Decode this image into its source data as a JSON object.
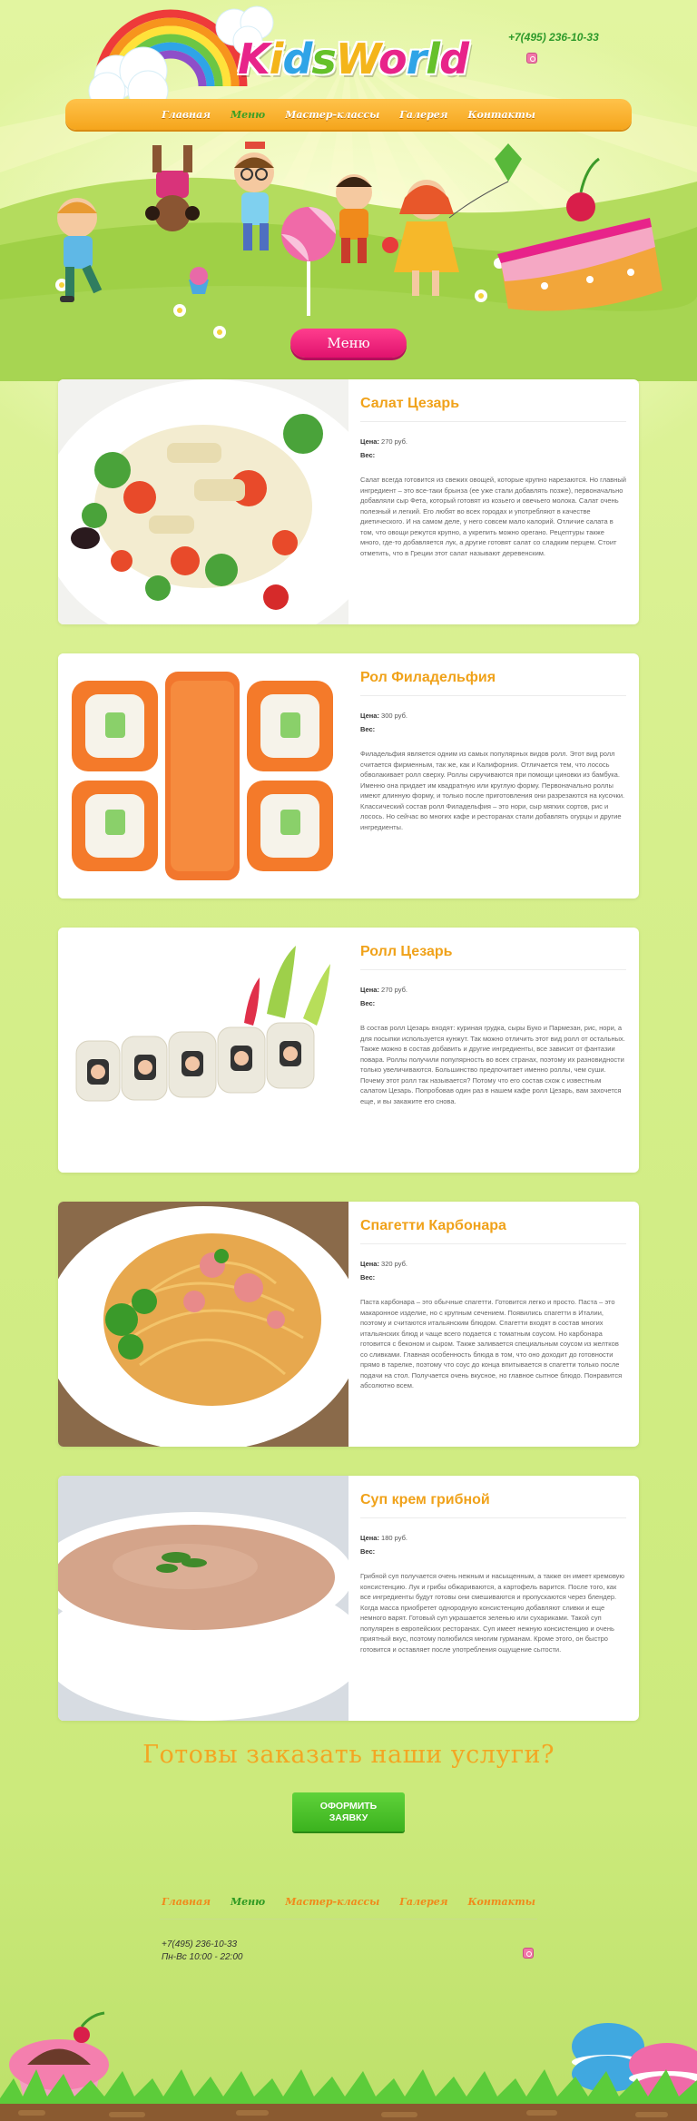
{
  "header": {
    "logo_text": "KidsWorld",
    "logo_letters": [
      {
        "ch": "K",
        "color": "#e8238a"
      },
      {
        "ch": "i",
        "color": "#f4b51a"
      },
      {
        "ch": "d",
        "color": "#2fa4e7"
      },
      {
        "ch": "s",
        "color": "#66c12a"
      },
      {
        "ch": "W",
        "color": "#f4b51a"
      },
      {
        "ch": "o",
        "color": "#e8238a"
      },
      {
        "ch": "r",
        "color": "#2fa4e7"
      },
      {
        "ch": "l",
        "color": "#66c12a"
      },
      {
        "ch": "d",
        "color": "#e8238a"
      }
    ],
    "phone": "+7(495) 236-10-33",
    "instagram_icon": "instagram-icon"
  },
  "nav": {
    "items": [
      {
        "label": "Главная",
        "active": false
      },
      {
        "label": "Меню",
        "active": true
      },
      {
        "label": "Мастер-классы",
        "active": false
      },
      {
        "label": "Галерея",
        "active": false
      },
      {
        "label": "Контакты",
        "active": false
      }
    ]
  },
  "menu_title": "Меню",
  "dishes": [
    {
      "title": "Салат Цезарь",
      "price_label": "Цена:",
      "price": "270 руб.",
      "weight_label": "Вес:",
      "description": "Салат всегда готовится из свежих овощей, которые крупно нарезаются. Но главный ингредиент – это все-таки брынза (ее уже стали добавлять позже), первоначально добавляли сыр Фета, который готовят из козьего и овечьего молока. Салат очень полезный и легкий. Его любят во всех городах и употребляют в качестве диетического. И на самом деле, у него совсем мало калорий. Отличие салата в том, что овощи режутся крупно, а укрепить можно орегано. Рецептуры также много, где-то добавляется лук, а другие готовят салат со сладким перцем. Стоит отметить, что в Греции этот салат называют деревенским.",
      "image": "caesar-salad"
    },
    {
      "title": "Рол Филадельфия",
      "price_label": "Цена:",
      "price": "300 руб.",
      "weight_label": "Вес:",
      "description": "Филадельфия является одним из самых популярных видов ролл. Этот вид ролл считается фирменным, так же, как и Калифорния. Отличается тем, что лосось обволакивает ролл сверху. Роллы скручиваются при помощи циновки из бамбука. Именно она придает им квадратную или круглую форму. Первоначально роллы имеют длинную форму, и только после приготовления они разрезаются на кусочки. Классический состав ролл Филадельфия – это нори, сыр мягких сортов, рис и лосось. Но сейчас во многих кафе и ресторанах стали добавлять огурцы и другие ингредиенты.",
      "image": "philadelphia-roll"
    },
    {
      "title": "Ролл Цезарь",
      "price_label": "Цена:",
      "price": "270 руб.",
      "weight_label": "Вес:",
      "description": "В состав ролл Цезарь входят: куриная грудка, сыры Буко и Пармезан, рис, нори, а для посыпки используется кунжут. Так можно отличить этот вид ролл от остальных. Также можно в состав добавить и другие ингредиенты, все зависит от фантазии повара. Роллы получили популярность во всех странах, поэтому их разновидности только увеличиваются. Большинство предпочитает именно роллы, чем суши. Почему этот ролл так называется? Потому что его состав схож с известным салатом Цезарь. Попробовав один раз в нашем кафе ролл Цезарь, вам захочется еще, и вы закажите его снова.",
      "image": "caesar-roll"
    },
    {
      "title": "Спагетти Карбонара",
      "price_label": "Цена:",
      "price": "320 руб.",
      "weight_label": "Вес:",
      "description": "Паста карбонара – это обычные спагетти. Готовится легко и просто. Паста – это макаронное изделие, но с крупным сечением. Появились спагетти в Италии, поэтому и считаются итальянским блюдом. Спагетти входят в состав многих итальянских блюд и чаще всего подается с томатным соусом. Но карбонара готовится с беконом и сыром. Также заливается специальным соусом из желтков со сливками. Главная особенность блюда в том, что оно доходит до готовности прямо в тарелке, поэтому что соус до конца впитывается в спагетти только после подачи на стол. Получается очень вкусное, но главное сытное блюдо. Понравится абсолютно всем.",
      "image": "spaghetti-carbonara"
    },
    {
      "title": "Суп крем грибной",
      "price_label": "Цена:",
      "price": "180 руб.",
      "weight_label": "Вес:",
      "description": "Грибной суп получается очень нежным и насыщенным, а также он имеет кремовую консистенцию. Лук и грибы обжариваются, а картофель варится. После того, как все ингредиенты будут готовы они смешиваются и пропускаются через блендер. Когда масса приобретет однородную консистенцию добавляют сливки и еще немного варят. Готовый суп украшается зеленью или сухариками. Такой суп популярен в европейских ресторанах. Суп имеет нежную консистенцию и очень приятный вкус, поэтому полюбился многим гурманам. Кроме этого, он быстро готовится и оставляет после употребления ощущение сытости.",
      "image": "mushroom-cream-soup"
    }
  ],
  "cta": {
    "title": "Готовы заказать наши услуги?",
    "button_line1": "ОФОРМИТЬ",
    "button_line2": "ЗАЯВКУ"
  },
  "footer": {
    "nav": [
      {
        "label": "Главная",
        "active": false
      },
      {
        "label": "Меню",
        "active": true
      },
      {
        "label": "Мастер-классы",
        "active": false
      },
      {
        "label": "Галерея",
        "active": false
      },
      {
        "label": "Контакты",
        "active": false
      }
    ],
    "phone": "+7(495) 236-10-33",
    "hours": "Пн-Вс 10:00 - 22:00",
    "instagram_icon": "instagram-icon"
  },
  "colors": {
    "accent": "#f3a623",
    "nav": "#f5a51c",
    "pink": "#e8238a",
    "green": "#3bb21e"
  }
}
